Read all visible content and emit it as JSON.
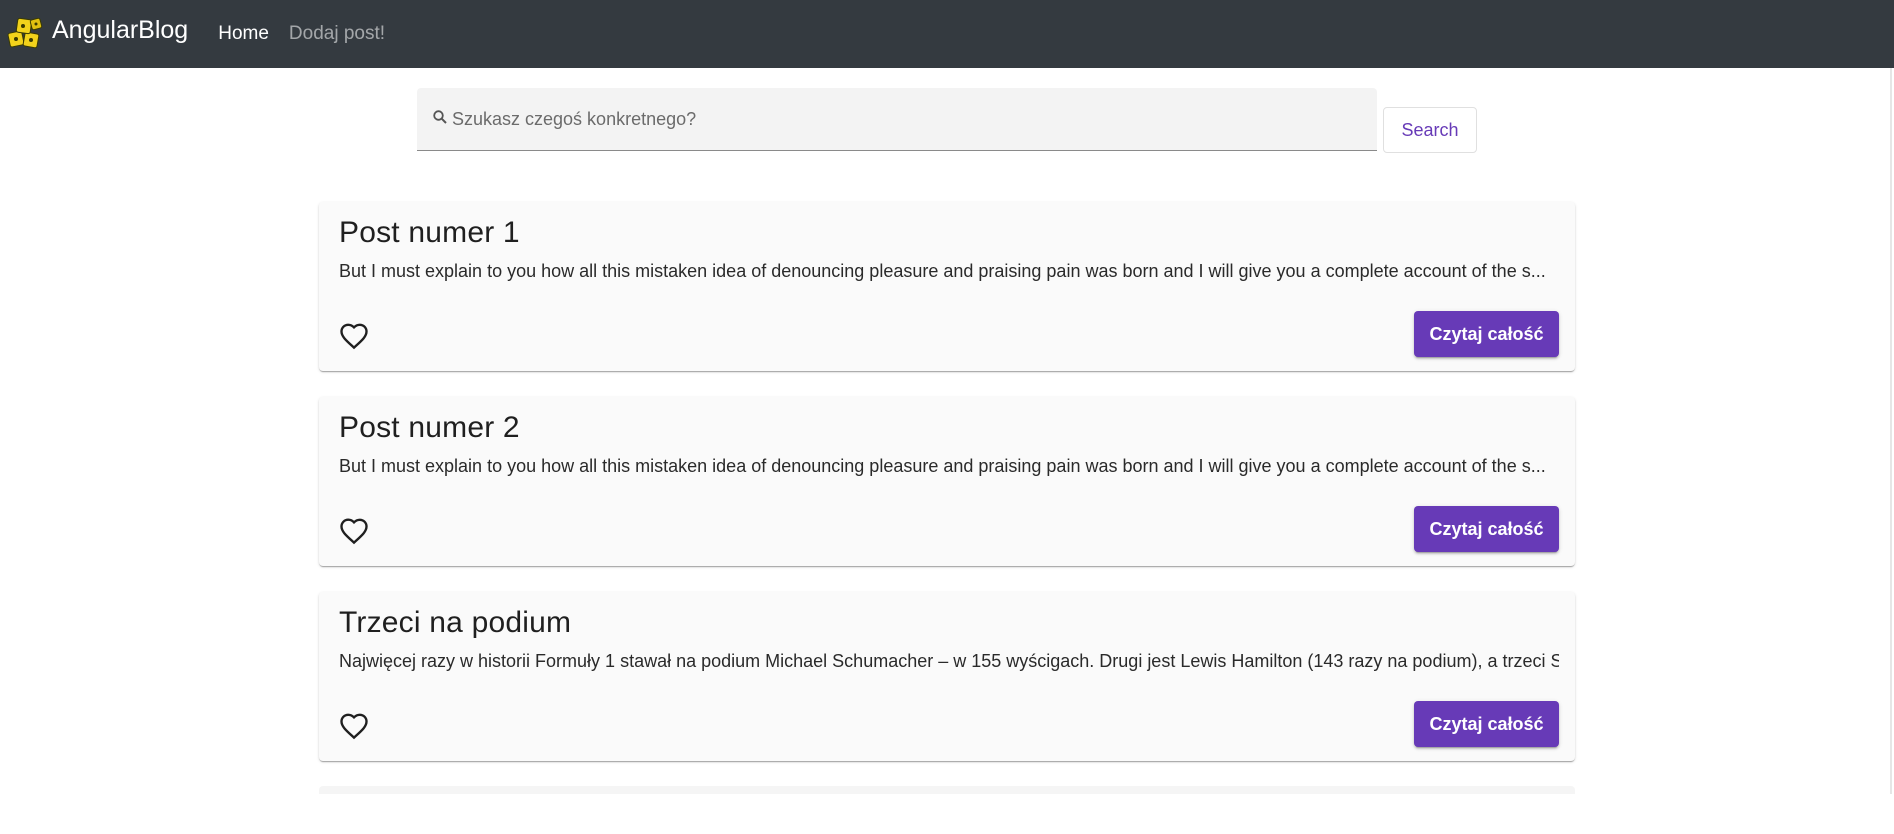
{
  "navbar": {
    "brand": "AngularBlog",
    "links": [
      {
        "label": "Home",
        "active": true
      },
      {
        "label": "Dodaj post!",
        "active": false
      }
    ]
  },
  "search": {
    "placeholder": "Szukasz czegoś konkretnego?",
    "value": "",
    "button_label": "Search"
  },
  "posts": [
    {
      "title": "Post numer 1",
      "excerpt": "But I must explain to you how all this mistaken idea of denouncing pleasure and praising pain was born and I will give you a complete account of the s...",
      "read_label": "Czytaj całość"
    },
    {
      "title": "Post numer 2",
      "excerpt": "But I must explain to you how all this mistaken idea of denouncing pleasure and praising pain was born and I will give you a complete account of the s...",
      "read_label": "Czytaj całość"
    },
    {
      "title": "Trzeci na podium",
      "excerpt": "Najwięcej razy w historii Formuły 1 stawał na podium Michael Schumacher – w 155 wyścigach. Drugi jest Lewis Hamilton (143 razy na podium), a trzeci Se...",
      "read_label": "Czytaj całość"
    }
  ],
  "colors": {
    "navbar_bg": "#343a40",
    "accent": "#673ab7",
    "card_bg": "#fafafa"
  },
  "icons": {
    "logo": "angular-blocks-logo-icon",
    "search": "search-icon",
    "like": "heart-outline-icon"
  }
}
